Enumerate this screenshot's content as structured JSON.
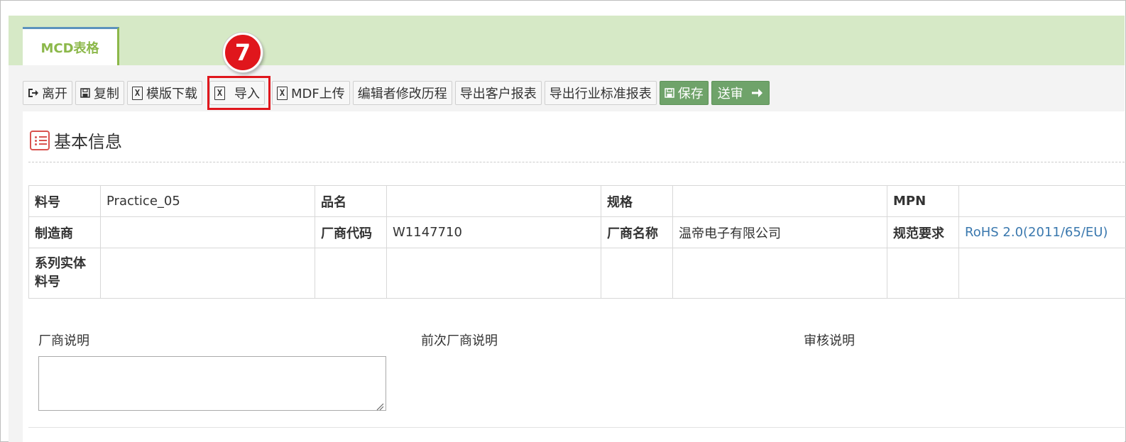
{
  "tab": {
    "label": "MCD表格"
  },
  "toolbar": {
    "leave": "离开",
    "copy": "复制",
    "template_download": "模版下载",
    "import": "导入",
    "mdf_upload": "MDF上传",
    "edit_history": "编辑者修改历程",
    "export_customer": "导出客户报表",
    "export_industry": "导出行业标准报表",
    "save": "保存",
    "submit": "送审"
  },
  "annotation": {
    "step": "7"
  },
  "section": {
    "title": "基本信息"
  },
  "info_table": {
    "row1": {
      "l1": "料号",
      "v1": "Practice_05",
      "l2": "品名",
      "v2": "",
      "l3": "规格",
      "v3": "",
      "l4": "MPN",
      "v4": ""
    },
    "row2": {
      "l1": "制造商",
      "v1": "",
      "l2": "厂商代码",
      "v2": "W1147710",
      "l3": "厂商名称",
      "v3": "温帝电子有限公司",
      "l4": "规范要求",
      "v4": "RoHS 2.0(2011/65/EU)"
    },
    "row3": {
      "l1": "系列实体料号",
      "v1": ""
    }
  },
  "notes": {
    "vendor_note": "厂商说明",
    "prev_vendor_note": "前次厂商说明",
    "review_note": "审核说明"
  },
  "colors": {
    "accent_green": "#8cb84a",
    "save_green": "#6fa36a",
    "highlight_red": "#e0161c",
    "link_blue": "#3a78ae"
  }
}
